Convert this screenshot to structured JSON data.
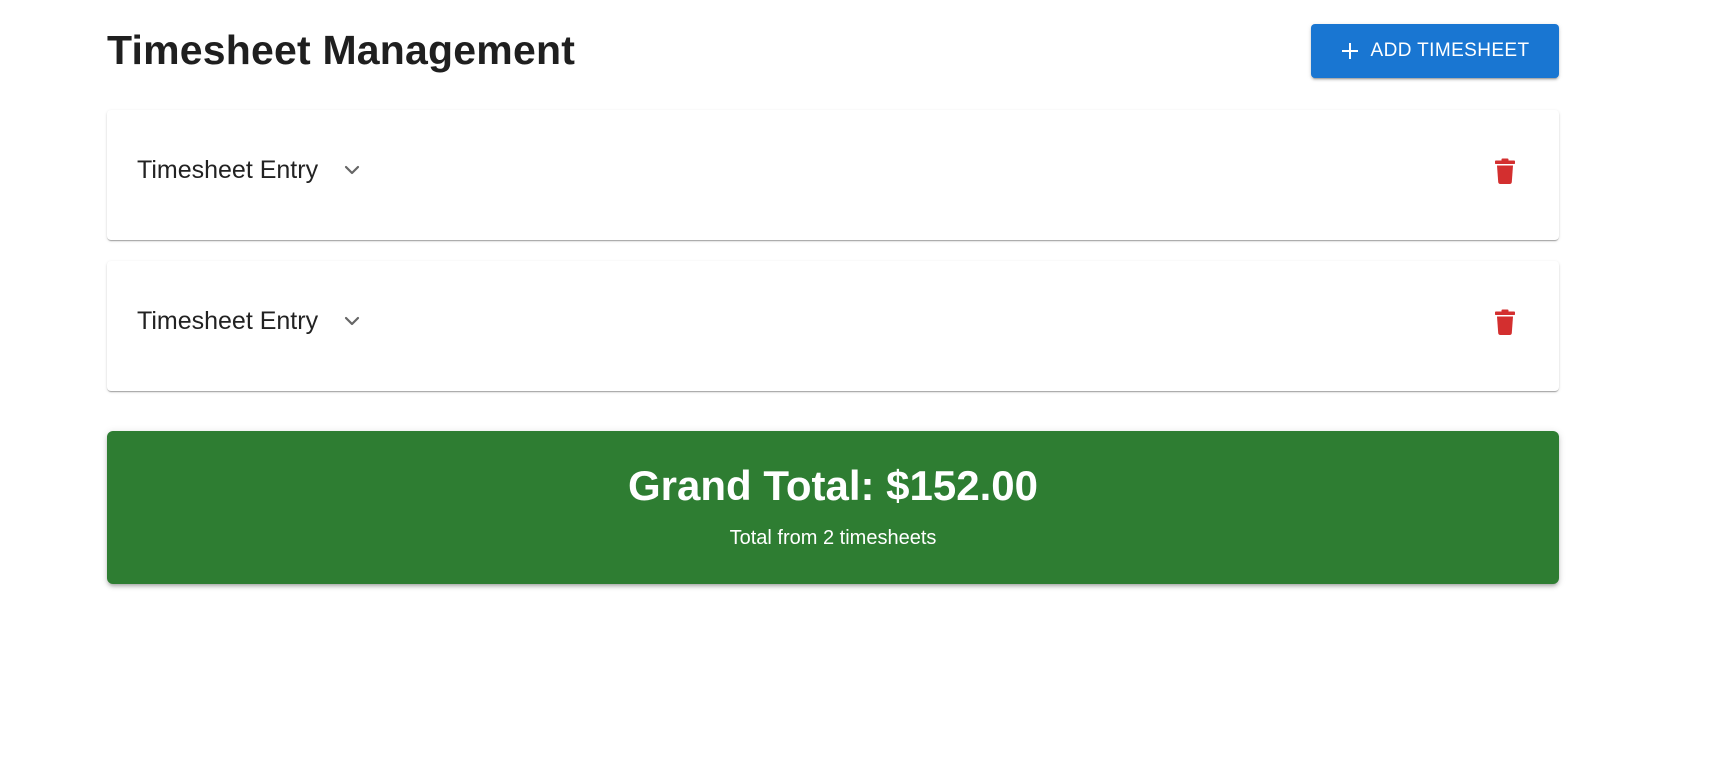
{
  "page": {
    "title": "Timesheet Management"
  },
  "toolbar": {
    "add_label": "ADD TIMESHEET",
    "add_icon": "plus-icon"
  },
  "timesheets": [
    {
      "title": "Timesheet Entry",
      "expand_icon": "chevron-down-icon",
      "delete_icon": "trash-icon"
    },
    {
      "title": "Timesheet Entry",
      "expand_icon": "chevron-down-icon",
      "delete_icon": "trash-icon"
    }
  ],
  "summary": {
    "grand_total": "Grand Total: $152.00",
    "caption": "Total from 2 timesheets"
  },
  "colors": {
    "primary": "#1976d2",
    "success": "#2e7d32",
    "danger": "#d32f2f"
  }
}
